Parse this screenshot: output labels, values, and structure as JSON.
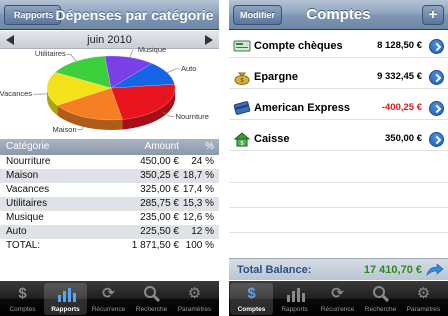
{
  "reports": {
    "back_label": "Rapports",
    "title": "Dépenses par catégorie",
    "month": "juin 2010",
    "chart_data": {
      "type": "pie",
      "title": "",
      "categories": [
        "Nourriture",
        "Maison",
        "Vacances",
        "Utilitaires",
        "Musique",
        "Auto"
      ],
      "values": [
        450.0,
        350.25,
        325.0,
        285.75,
        235.0,
        225.5
      ],
      "colors": [
        "#e8141e",
        "#f57f22",
        "#f3e21a",
        "#3ccf3b",
        "#7a3fe8",
        "#1565e6"
      ]
    },
    "table": {
      "headers": [
        "Catégorie",
        "Amount",
        "%"
      ],
      "rows": [
        {
          "name": "Nourriture",
          "amount": "450,00 €",
          "pct": "24 %"
        },
        {
          "name": "Maison",
          "amount": "350,25 €",
          "pct": "18,7 %"
        },
        {
          "name": "Vacances",
          "amount": "325,00 €",
          "pct": "17,4 %"
        },
        {
          "name": "Utilitaires",
          "amount": "285,75 €",
          "pct": "15,3 %"
        },
        {
          "name": "Musique",
          "amount": "235,00 €",
          "pct": "12,6 %"
        },
        {
          "name": "Auto",
          "amount": "225,50 €",
          "pct": "12 %"
        },
        {
          "name": "TOTAL:",
          "amount": "1 871,50 €",
          "pct": "100 %"
        }
      ]
    }
  },
  "accounts": {
    "edit_label": "Modifier",
    "title": "Comptes",
    "add_label": "+",
    "items": [
      {
        "name": "Compte chèques",
        "balance": "8 128,50 €",
        "negative": false,
        "icon": "checkbook-icon"
      },
      {
        "name": "Epargne",
        "balance": "9 332,45 €",
        "negative": false,
        "icon": "money-bag-icon"
      },
      {
        "name": "American Express",
        "balance": "-400,25 €",
        "negative": true,
        "icon": "credit-card-icon"
      },
      {
        "name": "Caisse",
        "balance": "350,00 €",
        "negative": false,
        "icon": "house-icon"
      }
    ],
    "total_label": "Total Balance:",
    "total_value": "17 410,70 €",
    "balance_colors": {
      "positive": "#000000",
      "negative": "#d81c1c",
      "total": "#2b8a1e"
    }
  },
  "tabs": [
    {
      "label": "Comptes",
      "icon": "dollar-icon"
    },
    {
      "label": "Rapports",
      "icon": "bar-chart-icon"
    },
    {
      "label": "Récurrence",
      "icon": "refresh-icon"
    },
    {
      "label": "Recherche",
      "icon": "search-icon"
    },
    {
      "label": "Paramètres",
      "icon": "gear-icon"
    }
  ],
  "left_active_tab": "Rapports",
  "right_active_tab": "Comptes"
}
